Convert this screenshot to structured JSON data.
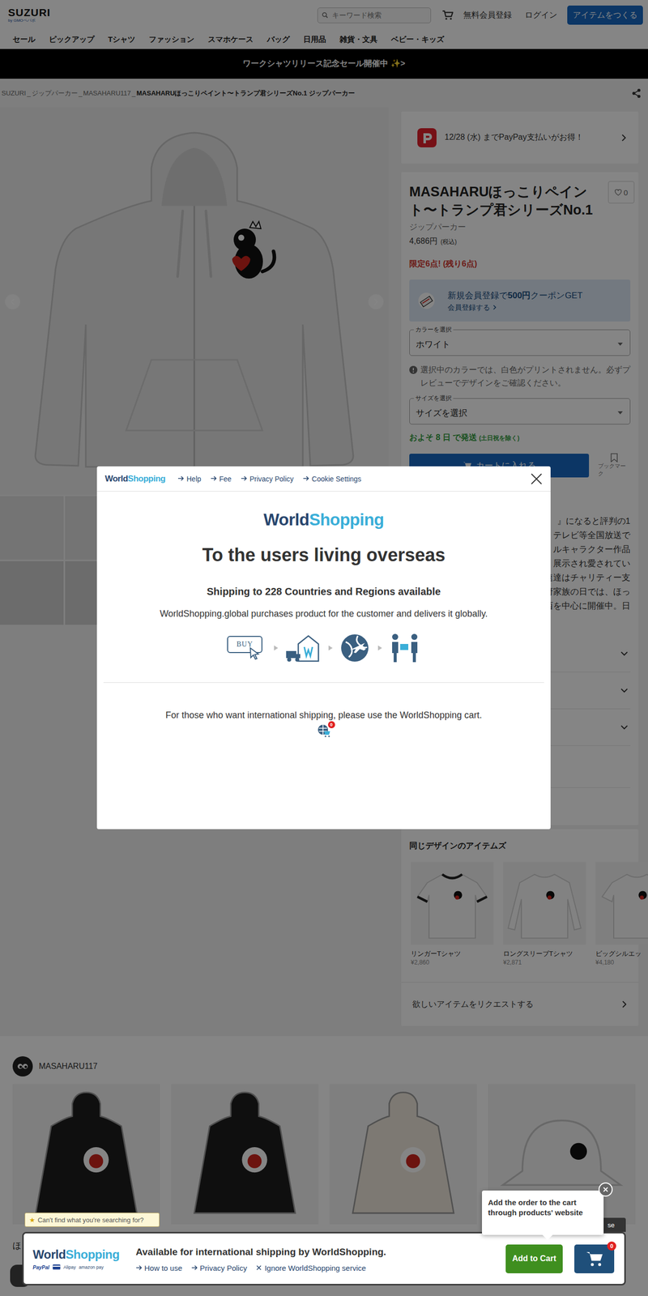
{
  "header": {
    "logo": "SUZURI",
    "logo_sub": "by GMOペパボ",
    "search_placeholder": "キーワード検索",
    "signup": "無料会員登録",
    "login": "ログイン",
    "create": "アイテムをつくる"
  },
  "nav": [
    "セール",
    "ピックアップ",
    "Tシャツ",
    "ファッション",
    "スマホケース",
    "バッグ",
    "日用品",
    "雑貨・文具",
    "ベビー・キッズ"
  ],
  "banner": "ワークシャツリリース記念セール開催中 ✨>",
  "breadcrumb": {
    "items": [
      "SUZURI",
      "ジップパーカー",
      "MASAHARU117"
    ],
    "separator": "_",
    "current": "MASAHARUほっこりペイント〜トランプ君シリーズNo.1 ジップパーカー"
  },
  "paypay": "12/28 (水) までPayPay支払いがお得！",
  "product": {
    "title": "MASAHARUほっこりペイント〜トランプ君シリーズNo.1",
    "likes": "0",
    "category": "ジップパーカー",
    "price": "4,686円",
    "tax": "(税込)",
    "stock": "限定6点! (残り6点)",
    "coupon": {
      "before": "新規会員登録で",
      "amount": "500円",
      "after": "クーポンGET",
      "link": "会員登録する"
    },
    "color": {
      "label": "カラーを選択",
      "value": "ホワイト"
    },
    "note": "選択中のカラーでは、白色がプリントされません。必ずプレビューでデザインをご確認ください。",
    "size": {
      "label": "サイズを選択",
      "value": "サイズを選択"
    },
    "shipping": "およそ 8 日 で発送",
    "shipping_note": "(土日祝を除く)",
    "cart_button": "カートに入れる",
    "bookmark": "ブックマーク",
    "description_lines": [
      "』になると評判の1",
      "テレビ等全国放送で",
      "ルキャラクター作品",
      "展示され愛されてい",
      "速達はチャリティー支",
      "府家族の日では、ほっ",
      "西を中心に開催中。日"
    ]
  },
  "same_design": {
    "title": "同じデザインのアイテムズ",
    "items": [
      {
        "name": "リンガーTシャツ",
        "price": "¥2,860",
        "kind": "ringer"
      },
      {
        "name": "ロングスリーブTシャツ",
        "price": "¥2,871",
        "kind": "longsleeve"
      },
      {
        "name": "ビッグシルエッ",
        "price": "¥4,180",
        "kind": "tee"
      }
    ],
    "request": "欲しいアイテムをリクエストする"
  },
  "creator": {
    "name": "MASAHARU117",
    "products": [
      {
        "kind": "hoodie",
        "color": "#1e1e1e"
      },
      {
        "kind": "hoodie",
        "color": "#1e1e1e"
      },
      {
        "kind": "hoodie",
        "color": "#efe9dc"
      },
      {
        "kind": "hat",
        "color": "#f3f3f3"
      }
    ],
    "first_title": "ほ"
  },
  "modal": {
    "logo": [
      "World",
      "Shopping"
    ],
    "links": [
      "Help",
      "Fee",
      "Privacy Policy",
      "Cookie Settings"
    ],
    "title": "To the users living overseas",
    "subtitle": "Shipping to 228 Countries and Regions available",
    "description": "WorldShopping.global purchases product for the customer and delivers it globally.",
    "buy_label": "BUY",
    "cart_text": "For those who want international shipping, please use the WorldShopping cart.",
    "cart_badge": "0"
  },
  "bottom_bar": {
    "hint_star": "★",
    "hint": "Can't find what you're searching for?",
    "logo": [
      "World",
      "Shopping"
    ],
    "payments": [
      "PayPal",
      "Alipay",
      "amazon pay"
    ],
    "message": "Available for international shipping by WorldShopping.",
    "links": [
      {
        "kind": "arrow",
        "label": "How to use"
      },
      {
        "kind": "arrow",
        "label": "Privacy Policy"
      },
      {
        "kind": "close",
        "label": "Ignore WorldShopping service"
      }
    ],
    "add_to_cart": "Add to Cart",
    "cart_badge": "0",
    "tooltip": "Add the order to the cart through products' website",
    "close_tab": "se"
  }
}
